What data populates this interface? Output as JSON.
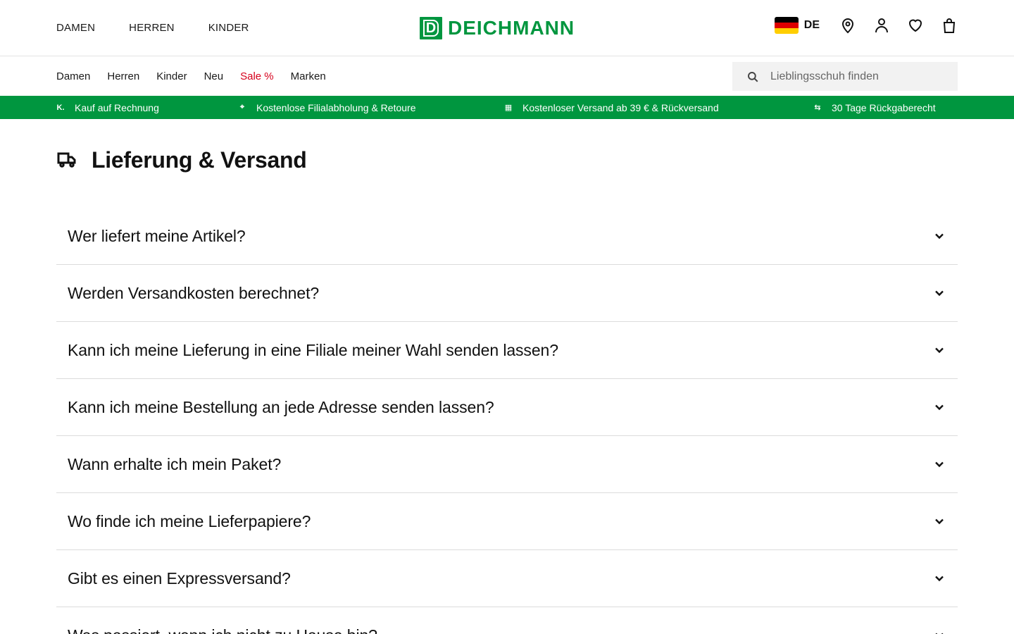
{
  "header": {
    "gender_nav": [
      "DAMEN",
      "HERREN",
      "KINDER"
    ],
    "logo_text": "DEICHMANN",
    "logo_mark": "D",
    "country_code": "DE",
    "icons": [
      "store-location-icon",
      "account-icon",
      "wishlist-heart-icon",
      "shopping-bag-icon"
    ]
  },
  "category_nav": {
    "items": [
      "Damen",
      "Herren",
      "Kinder",
      "Neu",
      "Sale %",
      "Marken"
    ],
    "sale_color": "#d6001c"
  },
  "search": {
    "placeholder": "Lieblingsschuh finden"
  },
  "benefits": {
    "color": "#00963f",
    "items": [
      {
        "icon": "invoice-icon",
        "glyph": "K.",
        "label": "Kauf auf Rechnung"
      },
      {
        "icon": "location-pin-icon",
        "glyph": "⌖",
        "label": "Kostenlose Filialabholung & Retoure"
      },
      {
        "icon": "store-icon",
        "glyph": "▦",
        "label": "Kostenloser Versand ab 39 € & Rückversand"
      },
      {
        "icon": "return-arrows-icon",
        "glyph": "⇆",
        "label": "30 Tage Rückgaberecht"
      }
    ]
  },
  "page": {
    "title": "Lieferung & Versand",
    "title_icon": "delivery-truck-icon"
  },
  "faq": [
    "Wer liefert meine Artikel?",
    "Werden Versandkosten berechnet?",
    "Kann ich meine Lieferung in eine Filiale meiner Wahl senden lassen?",
    "Kann ich meine Bestellung an jede Adresse senden lassen?",
    "Wann erhalte ich mein Paket?",
    "Wo finde ich meine Lieferpapiere?",
    "Gibt es einen Expressversand?",
    "Was passiert, wenn ich nicht zu Hause bin?"
  ]
}
